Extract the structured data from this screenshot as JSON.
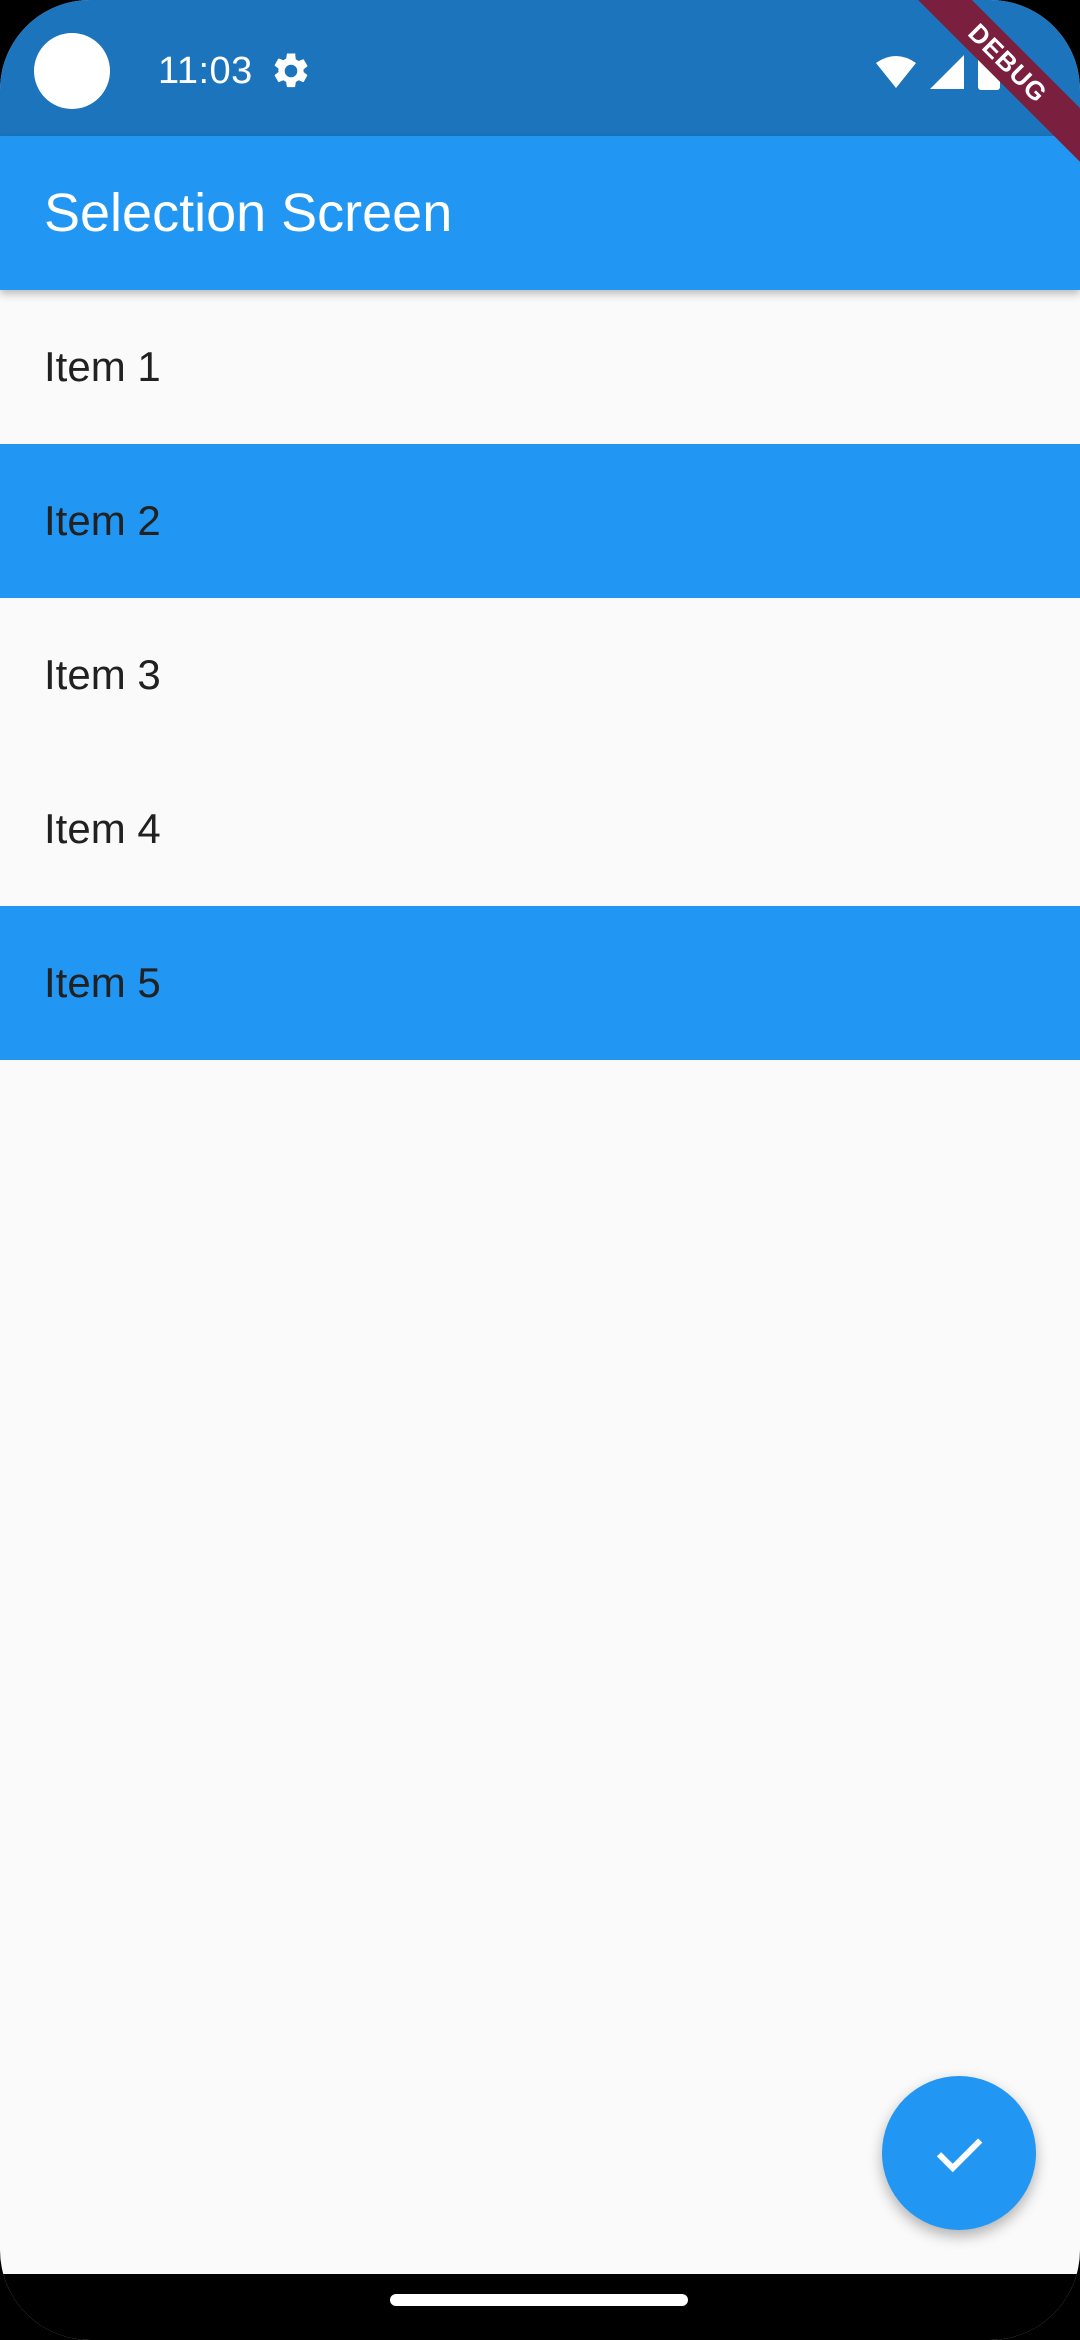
{
  "status_bar": {
    "time": "11:03",
    "icons": [
      "camera-cutout",
      "settings-icon",
      "wifi-icon",
      "signal-icon",
      "battery-icon"
    ]
  },
  "debug_banner": "DEBUG",
  "app_bar": {
    "title": "Selection Screen",
    "color": "#2196f3"
  },
  "list": {
    "items": [
      {
        "label": "Item 1",
        "selected": false
      },
      {
        "label": "Item 2",
        "selected": true
      },
      {
        "label": "Item 3",
        "selected": false
      },
      {
        "label": "Item 4",
        "selected": false
      },
      {
        "label": "Item 5",
        "selected": true
      }
    ],
    "selected_color": "#2196f3"
  },
  "fab": {
    "icon": "check-icon",
    "color": "#2196f3"
  }
}
